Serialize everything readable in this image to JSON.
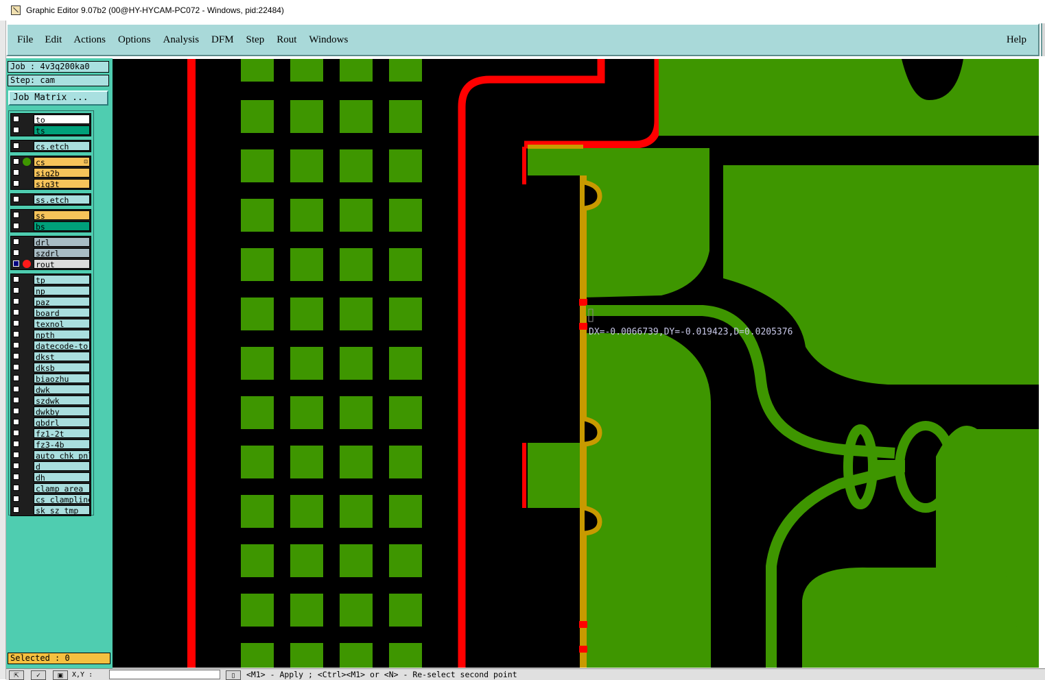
{
  "window": {
    "title": "Graphic Editor 9.07b2 (00@HY-HYCAM-PC072 - Windows, pid:22484)"
  },
  "menu": {
    "items": [
      "File",
      "Edit",
      "Actions",
      "Options",
      "Analysis",
      "DFM",
      "Step",
      "Rout",
      "Windows"
    ],
    "help": "Help"
  },
  "job": {
    "label": "Job : 4v3q200ka0",
    "step": "Step: cam",
    "matrix_button": "Job Matrix ..."
  },
  "layers": {
    "groups": [
      [
        {
          "name": "to",
          "color": "#ffffff"
        },
        {
          "name": "ts",
          "color": "#00a07a"
        }
      ],
      [
        {
          "name": "cs.etch",
          "color": "#a9dede"
        }
      ],
      [
        {
          "name": "cs",
          "color": "#f6c35a",
          "work": true,
          "mark": "⊡"
        },
        {
          "name": "sig2b",
          "color": "#f6c35a"
        },
        {
          "name": "sig3t",
          "color": "#f6c35a"
        }
      ],
      [
        {
          "name": "ss.etch",
          "color": "#a9dede"
        }
      ],
      [
        {
          "name": "ss",
          "color": "#f6c35a"
        },
        {
          "name": "bs",
          "color": "#00a07a"
        }
      ],
      [
        {
          "name": "drl",
          "color": "#a8bcc4"
        },
        {
          "name": "szdrl",
          "color": "#a8bcc4"
        },
        {
          "name": "rout",
          "color": "#dcdcdc",
          "affected": true,
          "display": true
        }
      ],
      [
        {
          "name": "tp",
          "color": "#a9dede"
        },
        {
          "name": "np",
          "color": "#a9dede"
        },
        {
          "name": "paz",
          "color": "#a9dede"
        },
        {
          "name": "board",
          "color": "#a9dede"
        },
        {
          "name": "texnol",
          "color": "#a9dede"
        },
        {
          "name": "npth",
          "color": "#a9dede"
        },
        {
          "name": "datecode-to",
          "color": "#a9dede"
        },
        {
          "name": "dkst",
          "color": "#a9dede"
        },
        {
          "name": "dksb",
          "color": "#a9dede"
        },
        {
          "name": "biaozhu",
          "color": "#a9dede"
        },
        {
          "name": "dwk",
          "color": "#a9dede"
        },
        {
          "name": "szdwk",
          "color": "#a9dede"
        },
        {
          "name": "dwkby",
          "color": "#a9dede"
        },
        {
          "name": "gbdrl",
          "color": "#a9dede"
        },
        {
          "name": "fz1-2t",
          "color": "#a9dede"
        },
        {
          "name": "fz3-4b",
          "color": "#a9dede"
        },
        {
          "name": "auto_chk_pnl",
          "color": "#a9dede"
        },
        {
          "name": "d",
          "color": "#a9dede"
        },
        {
          "name": "dh",
          "color": "#a9dede"
        },
        {
          "name": "clamp_area",
          "color": "#a9dede"
        },
        {
          "name": "cs_clampline",
          "color": "#a9dede"
        },
        {
          "name": "sk_sz_tmp",
          "color": "#a9dede"
        }
      ]
    ]
  },
  "selected": "Selected : 0",
  "measurement": "DX=-0.0066739,DY=-0.019423,D=0.0205376",
  "status": {
    "xy_label": "X,Y :",
    "prompt": "<M1> - Apply  ; <Ctrl><M1> or <N> - Re-select second point"
  },
  "colors": {
    "copper": "#3e9600",
    "rout": "#ff0000",
    "overlap": "#c89a00",
    "background": "#000000",
    "panel": "#4fcdb0",
    "menubar": "#a9d9d9"
  }
}
